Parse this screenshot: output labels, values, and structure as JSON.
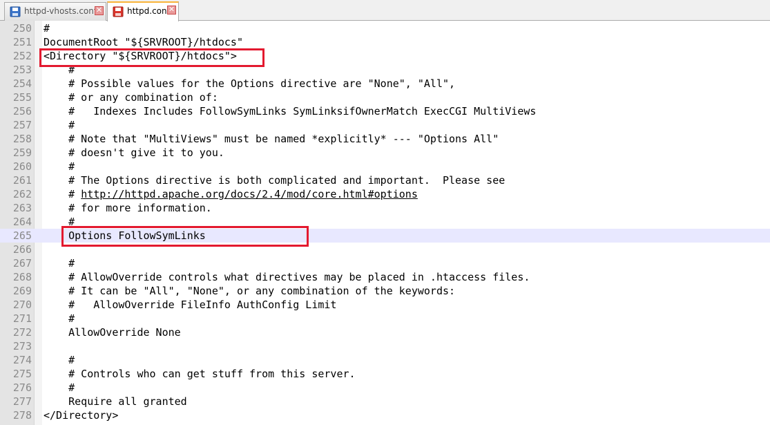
{
  "tabs": [
    {
      "label": "httpd-vhosts.conf",
      "active": false,
      "icon": "save-disk-icon"
    },
    {
      "label": "httpd.conf",
      "active": true,
      "icon": "unsaved-disk-icon"
    }
  ],
  "colors": {
    "highlight_box": "#e3192f",
    "current_line": "#e8e8ff",
    "active_tab_accent": "#f9b338"
  },
  "editor": {
    "current_line": 265,
    "lines": [
      {
        "number": "250",
        "text": "#"
      },
      {
        "number": "251",
        "text": "DocumentRoot \"${SRVROOT}/htdocs\""
      },
      {
        "number": "252",
        "text": "<Directory \"${SRVROOT}/htdocs\">"
      },
      {
        "number": "253",
        "text": "    #"
      },
      {
        "number": "254",
        "text": "    # Possible values for the Options directive are \"None\", \"All\","
      },
      {
        "number": "255",
        "text": "    # or any combination of:"
      },
      {
        "number": "256",
        "text": "    #   Indexes Includes FollowSymLinks SymLinksifOwnerMatch ExecCGI MultiViews"
      },
      {
        "number": "257",
        "text": "    #"
      },
      {
        "number": "258",
        "text": "    # Note that \"MultiViews\" must be named *explicitly* --- \"Options All\""
      },
      {
        "number": "259",
        "text": "    # doesn't give it to you."
      },
      {
        "number": "260",
        "text": "    #"
      },
      {
        "number": "261",
        "text": "    # The Options directive is both complicated and important.  Please see"
      },
      {
        "number": "262",
        "prefix": "    # ",
        "link": "http://httpd.apache.org/docs/2.4/mod/core.html#options"
      },
      {
        "number": "263",
        "text": "    # for more information."
      },
      {
        "number": "264",
        "text": "    #"
      },
      {
        "number": "265",
        "text": "    Options FollowSymLinks"
      },
      {
        "number": "266",
        "text": ""
      },
      {
        "number": "267",
        "text": "    #"
      },
      {
        "number": "268",
        "text": "    # AllowOverride controls what directives may be placed in .htaccess files."
      },
      {
        "number": "269",
        "text": "    # It can be \"All\", \"None\", or any combination of the keywords:"
      },
      {
        "number": "270",
        "text": "    #   AllowOverride FileInfo AuthConfig Limit"
      },
      {
        "number": "271",
        "text": "    #"
      },
      {
        "number": "272",
        "text": "    AllowOverride None"
      },
      {
        "number": "273",
        "text": ""
      },
      {
        "number": "274",
        "text": "    #"
      },
      {
        "number": "275",
        "text": "    # Controls who can get stuff from this server."
      },
      {
        "number": "276",
        "text": "    #"
      },
      {
        "number": "277",
        "text": "    Require all granted"
      },
      {
        "number": "278",
        "text": "</Directory>"
      }
    ]
  }
}
